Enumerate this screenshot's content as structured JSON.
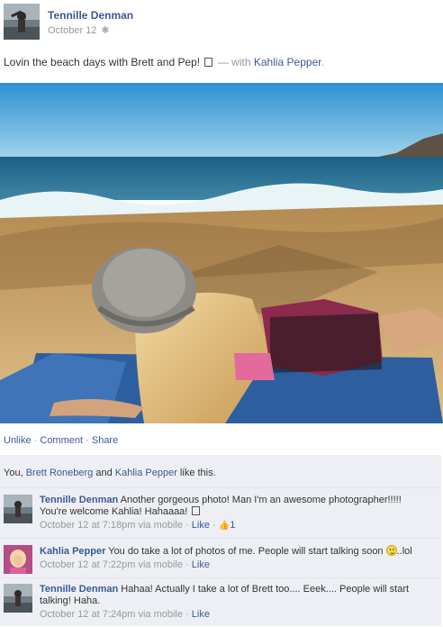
{
  "post": {
    "author": "Tennille Denman",
    "date": "October 12",
    "message_text": "Lovin the beach days with Brett and Pep!",
    "message_dash": "—",
    "message_with": "with",
    "tagged_person": "Kahlia Pepper",
    "tagged_end": "."
  },
  "actions": {
    "unlike": "Unlike",
    "sep1": "·",
    "comment": "Comment",
    "sep2": "·",
    "share": "Share"
  },
  "likes": {
    "prefix": "You, ",
    "person1": "Brett Roneberg",
    "mid": " and ",
    "person2": "Kahlia Pepper",
    "suffix": " like this."
  },
  "comments": [
    {
      "author": "Tennille Denman",
      "text_line1": "Another gorgeous photo! Man I'm an awesome photographer!!!!!",
      "text_line2": "You're welcome Kahlia! Hahaaaa!",
      "time": "October 12 at 7:18pm via mobile",
      "dot": "·",
      "like": "Like",
      "dot2": "·",
      "like_count": "1"
    },
    {
      "author": "Kahlia Pepper",
      "text": "You do take a lot of photos of me. People will start talking soon",
      "text_end": "..lol",
      "time": "October 12 at 7:22pm via mobile",
      "dot": "·",
      "like": "Like"
    },
    {
      "author": "Tennille Denman",
      "text": "Hahaa! Actually I take a lot of Brett too.... Eeek.... People will start talking! Haha.",
      "time": "October 12 at 7:24pm via mobile",
      "dot": "·",
      "like": "Like"
    }
  ],
  "colors": {
    "link": "#3b5998",
    "muted": "#999999",
    "feedback_bg": "#edeff4"
  },
  "icons": [
    "gear-icon",
    "emoji-box-icon",
    "thumbs-up-icon",
    "smiley-icon"
  ]
}
